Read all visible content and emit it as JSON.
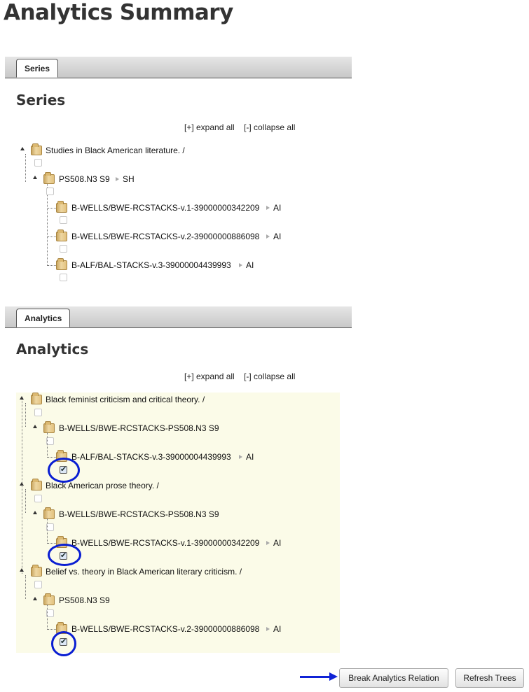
{
  "page_title": "Analytics Summary",
  "series_section": {
    "tab_label": "Series",
    "heading": "Series",
    "expand_all": "[+] expand all",
    "collapse_all": "[-] collapse all",
    "root_label": "Studies in Black American literature. /",
    "child_label": "PS508.N3 S9",
    "child_code": "SH",
    "items": [
      {
        "label": "B-WELLS/BWE-RCSTACKS-v.1-39000000342209",
        "code": "AI"
      },
      {
        "label": "B-WELLS/BWE-RCSTACKS-v.2-39000000886098",
        "code": "AI"
      },
      {
        "label": "B-ALF/BAL-STACKS-v.3-39000004439993",
        "code": "AI"
      }
    ]
  },
  "analytics_section": {
    "tab_label": "Analytics",
    "heading": "Analytics",
    "expand_all": "[+] expand all",
    "collapse_all": "[-] collapse all",
    "groups": [
      {
        "title": "Black feminist criticism and critical theory. /",
        "child": "B-WELLS/BWE-RCSTACKS-PS508.N3 S9",
        "leaf": "B-ALF/BAL-STACKS-v.3-39000004439993",
        "leaf_code": "AI",
        "checked": true
      },
      {
        "title": "Black American prose theory. /",
        "child": "B-WELLS/BWE-RCSTACKS-PS508.N3 S9",
        "leaf": "B-WELLS/BWE-RCSTACKS-v.1-39000000342209",
        "leaf_code": "AI",
        "checked": true
      },
      {
        "title": "Belief vs. theory in Black American literary criticism. /",
        "child": "PS508.N3 S9",
        "leaf": "B-WELLS/BWE-RCSTACKS-v.2-39000000886098",
        "leaf_code": "AI",
        "checked": true
      }
    ]
  },
  "buttons": {
    "break_relation": "Break Analytics Relation",
    "refresh_trees": "Refresh Trees"
  },
  "colors": {
    "annotation": "#0a1ed2",
    "highlight": "#fbfbe8"
  }
}
